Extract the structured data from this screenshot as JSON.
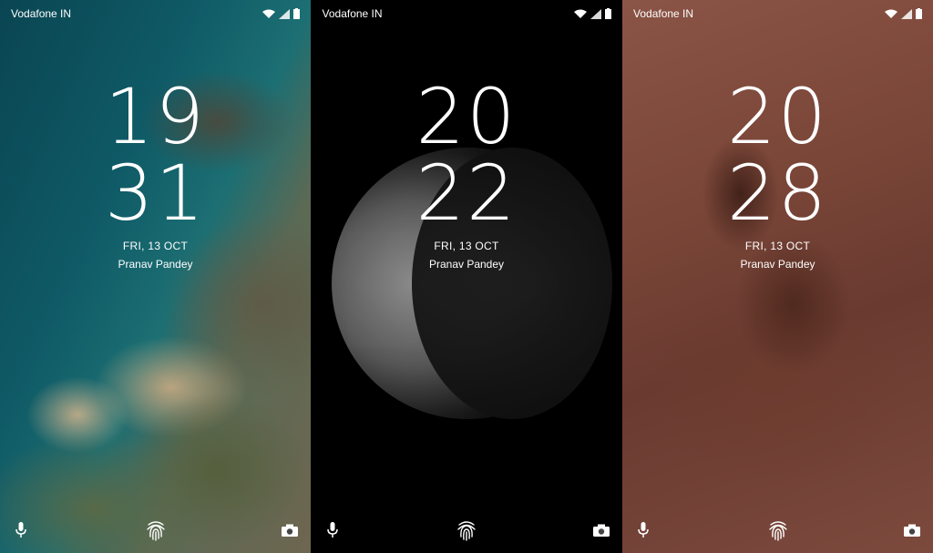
{
  "screens": [
    {
      "carrier": "Vodafone IN",
      "hour": "19",
      "minute": "31",
      "date": "FRI, 13 OCT",
      "owner": "Pranav Pandey",
      "wallpaper": "coastline"
    },
    {
      "carrier": "Vodafone IN",
      "hour": "20",
      "minute": "22",
      "date": "FRI, 13 OCT",
      "owner": "Pranav Pandey",
      "wallpaper": "moon"
    },
    {
      "carrier": "Vodafone IN",
      "hour": "20",
      "minute": "28",
      "date": "FRI, 13 OCT",
      "owner": "Pranav Pandey",
      "wallpaper": "desert"
    }
  ],
  "icons": {
    "status": [
      "wifi-icon",
      "signal-icon",
      "battery-icon"
    ],
    "bottom": [
      "microphone-icon",
      "fingerprint-icon",
      "camera-icon"
    ]
  },
  "colors": {
    "text": "#ffffff"
  }
}
